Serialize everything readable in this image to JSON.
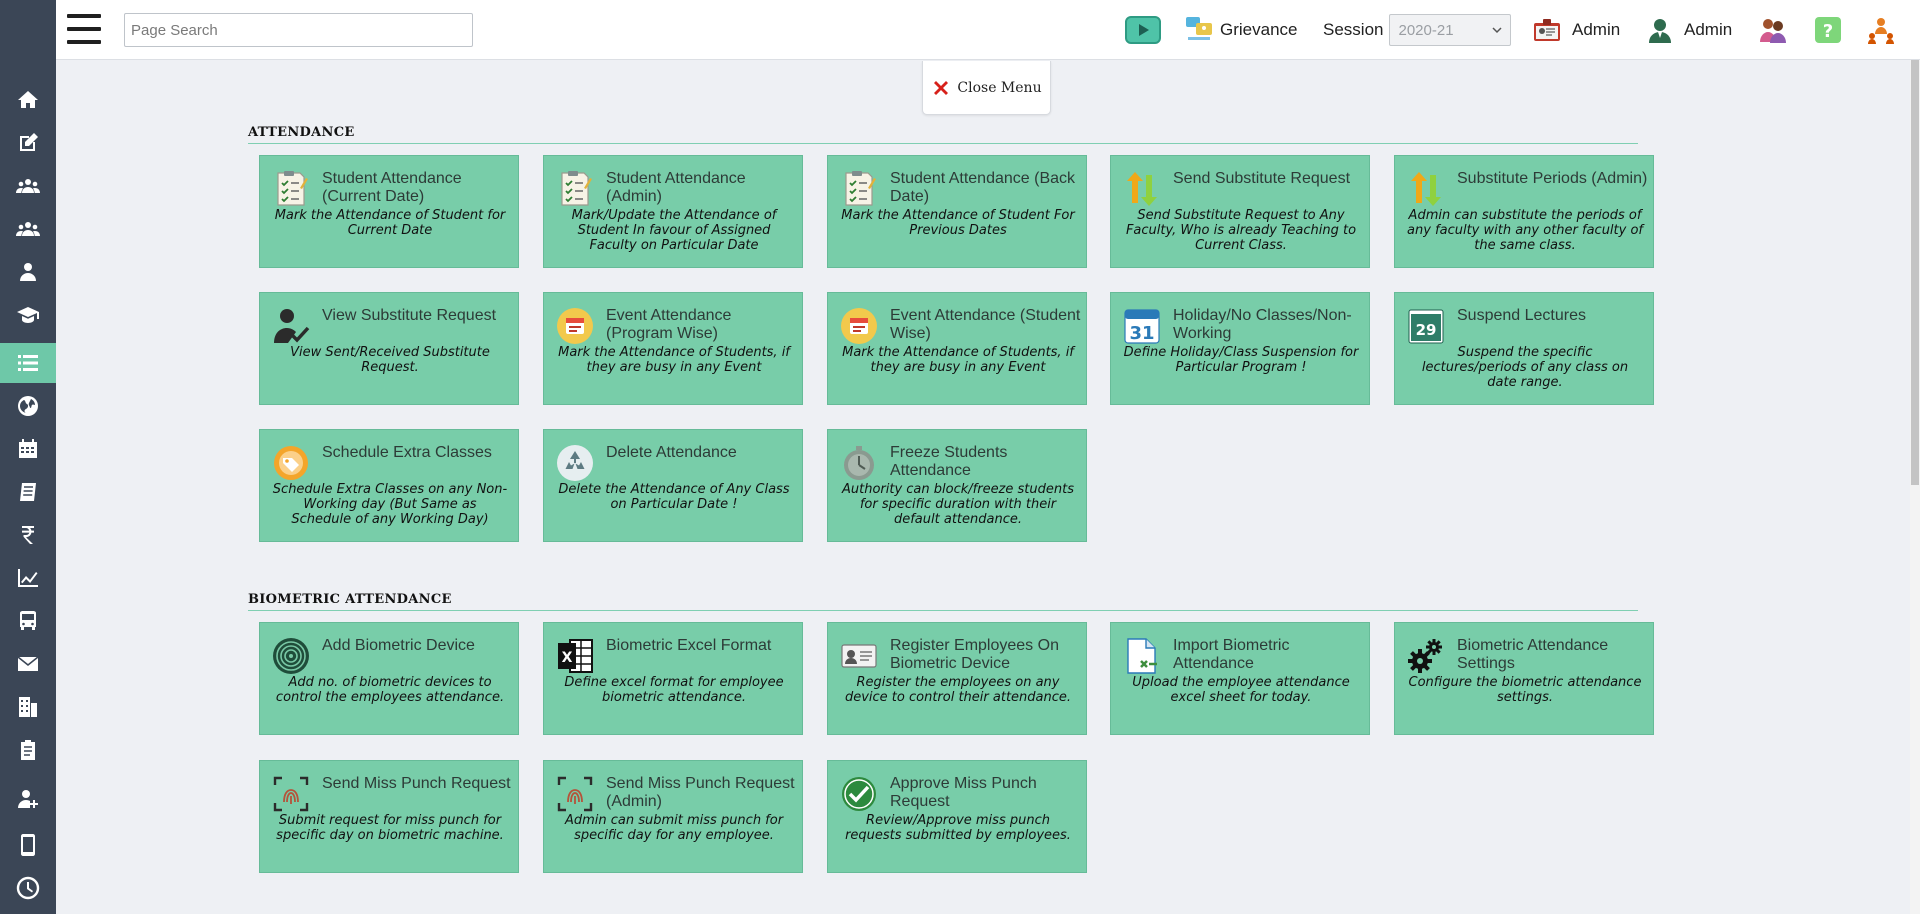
{
  "header": {
    "search_placeholder": "Page Search",
    "grievance_label": "Grievance",
    "session_label": "Session",
    "session_value": "2020-21",
    "admin_label_1": "Admin",
    "admin_label_2": "Admin"
  },
  "close_menu": "Close Menu",
  "sections": {
    "attendance_title": "ATTENDANCE",
    "biometric_title": "BIOMETRIC ATTENDANCE"
  },
  "attendance_tiles": [
    {
      "title": "Student Attendance (Current Date)",
      "desc": "Mark the Attendance of Student for Current Date",
      "icon": "checklist-icon"
    },
    {
      "title": "Student Attendance (Admin)",
      "desc": "Mark/Update the Attendance of Student In favour of Assigned Faculty on Particular Date",
      "icon": "checklist-icon"
    },
    {
      "title": "Student Attendance (Back Date)",
      "desc": "Mark the Attendance of Student For Previous Dates",
      "icon": "checklist-icon"
    },
    {
      "title": "Send Substitute Request",
      "desc": "Send Substitute Request to Any Faculty, Who is already Teaching to Current Class.",
      "icon": "swap-arrows-icon"
    },
    {
      "title": "Substitute Periods (Admin)",
      "desc": "Admin can substitute the periods of any faculty with any other faculty of the same class.",
      "icon": "swap-arrows-icon"
    },
    {
      "title": "View Substitute Request",
      "desc": "View Sent/Received Substitute Request.",
      "icon": "user-check-icon"
    },
    {
      "title": "Event Attendance (Program Wise)",
      "desc": "Mark the Attendance of Students, if they are busy in any Event",
      "icon": "event-calendar-icon"
    },
    {
      "title": "Event Attendance (Student Wise)",
      "desc": "Mark the Attendance of Students, if they are busy in any Event",
      "icon": "event-calendar-icon"
    },
    {
      "title": "Holiday/No Classes/Non-Working",
      "desc": "Define Holiday/Class Suspension for Particular Program !",
      "icon": "calendar-31-icon"
    },
    {
      "title": "Suspend Lectures",
      "desc": "Suspend the specific lectures/periods of any class on date range.",
      "icon": "calendar-29-icon"
    },
    {
      "title": "Schedule Extra Classes",
      "desc": "Schedule Extra Classes on any Non-Working day (But Same as Schedule of any Working Day)",
      "icon": "schedule-tag-icon"
    },
    {
      "title": "Delete Attendance",
      "desc": "Delete the Attendance of Any Class on Particular Date !",
      "icon": "recycle-icon"
    },
    {
      "title": "Freeze Students Attendance",
      "desc": "Authority can block/freeze students for specific duration with their default attendance.",
      "icon": "stopwatch-icon"
    }
  ],
  "biometric_tiles": [
    {
      "title": "Add Biometric Device",
      "desc": "Add no. of biometric devices to control the employees attendance.",
      "icon": "fingerprint-icon"
    },
    {
      "title": "Biometric Excel Format",
      "desc": "Define excel format for employee biometric attendance.",
      "icon": "excel-icon"
    },
    {
      "title": "Register Employees On Biometric Device",
      "desc": "Register the employees on any device to control their attendance.",
      "icon": "id-card-icon"
    },
    {
      "title": "Import Biometric Attendance",
      "desc": "Upload the employee attendance excel sheet for today.",
      "icon": "import-file-icon"
    },
    {
      "title": "Biometric Attendance Settings",
      "desc": "Configure the biometric attendance settings.",
      "icon": "gears-icon"
    },
    {
      "title": "Send Miss Punch Request",
      "desc": "Submit request for miss punch for specific day on biometric machine.",
      "icon": "fingerprint-scan-icon"
    },
    {
      "title": "Send Miss Punch Request (Admin)",
      "desc": "Admin can submit miss punch for specific day for any employee.",
      "icon": "fingerprint-scan-icon"
    },
    {
      "title": "Approve Miss Punch Request",
      "desc": "Review/Approve miss punch requests submitted by employees.",
      "icon": "check-circle-icon"
    }
  ],
  "calendar_days": {
    "holiday": "31",
    "suspend": "29"
  },
  "excel_letter": "X",
  "colors": {
    "sidebar_bg": "#3b4656",
    "sidebar_active": "#6ec8a8",
    "tile_bg": "#78cda9",
    "section_line": "#7fcfb2"
  }
}
